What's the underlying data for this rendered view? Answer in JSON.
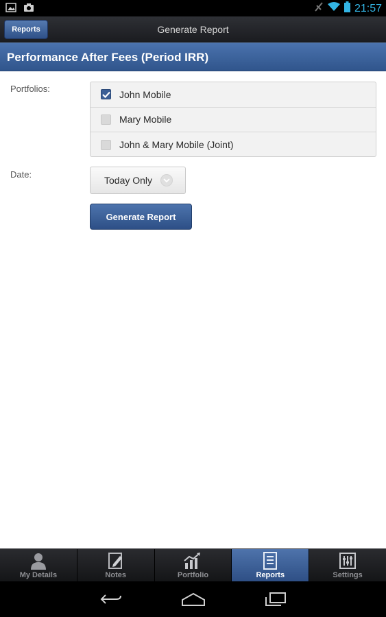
{
  "status_bar": {
    "time": "21:57",
    "left_icons": [
      "picture-icon",
      "camera-icon"
    ],
    "right_icons": [
      "no-signal-icon",
      "wifi-icon",
      "battery-icon"
    ]
  },
  "action_bar": {
    "back_button_label": "Reports",
    "title": "Generate Report"
  },
  "page": {
    "title": "Performance After Fees (Period IRR)"
  },
  "form": {
    "portfolios_label": "Portfolios:",
    "portfolios": [
      {
        "label": "John Mobile",
        "checked": true
      },
      {
        "label": "Mary Mobile",
        "checked": false
      },
      {
        "label": "John & Mary Mobile (Joint)",
        "checked": false
      }
    ],
    "date_label": "Date:",
    "date_value": "Today Only",
    "generate_button": "Generate Report"
  },
  "tabs": [
    {
      "label": "My Details",
      "icon": "person-icon",
      "active": false
    },
    {
      "label": "Notes",
      "icon": "notes-icon",
      "active": false
    },
    {
      "label": "Portfolio",
      "icon": "chart-icon",
      "active": false
    },
    {
      "label": "Reports",
      "icon": "report-icon",
      "active": true
    },
    {
      "label": "Settings",
      "icon": "sliders-icon",
      "active": false
    }
  ],
  "nav_bar": {
    "buttons": [
      "back-icon",
      "home-icon",
      "recents-icon"
    ]
  },
  "colors": {
    "accent": "#33b5e5",
    "brand_blue": "#3b5f96"
  }
}
